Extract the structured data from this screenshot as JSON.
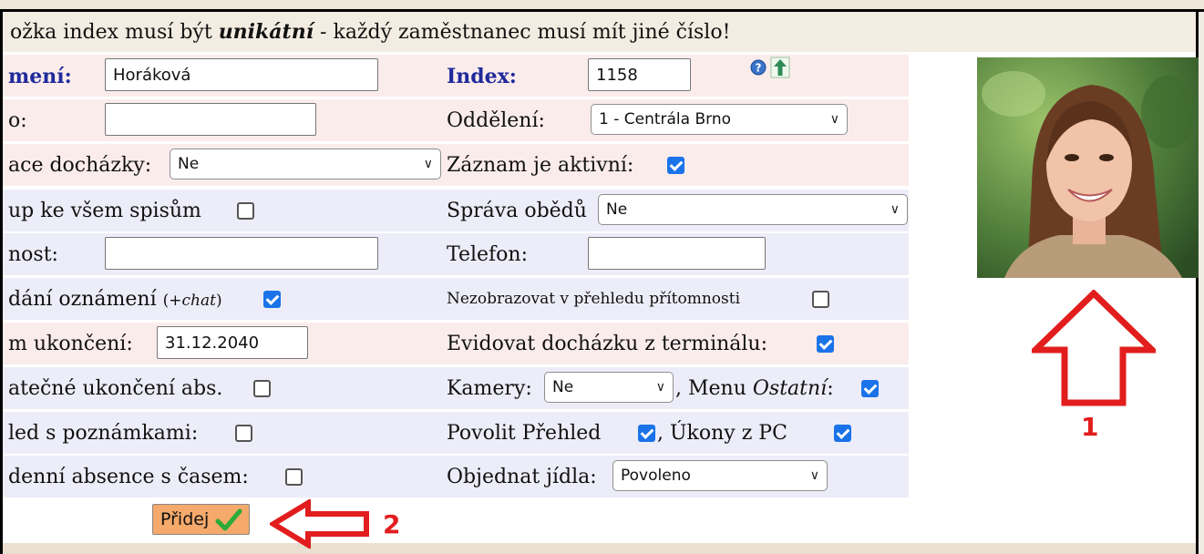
{
  "notice": {
    "prefix": "ožka index musí být ",
    "emph": "unikátní",
    "suffix": " - každý zaměstnanec musí mít jiné číslo!"
  },
  "form": {
    "surname_label": "mení:",
    "surname_value": "Horáková",
    "index_label": "Index:",
    "index_value": "1158",
    "row2_label": "o:",
    "row2_value": "",
    "department_label": "Oddělení:",
    "department_value": "1 - Centrála Brno",
    "attendance_label": "ace docházky:",
    "attendance_value": "Ne",
    "active_label": "Záznam je aktivní:",
    "files_label": "up ke všem spisům",
    "lunch_mgmt_label": "Správa obědů",
    "lunch_mgmt_value": "Ne",
    "position_label": "nost:",
    "position_value": "",
    "phone_label": "Telefon:",
    "phone_value": "",
    "announce_label": "dání oznámení",
    "announce_suffix_open": "(+",
    "announce_suffix_chat": "chat",
    "announce_suffix_close": ")",
    "hide_presence_label": "Nezobrazovat v přehledu přítomnosti",
    "end_date_label": "m ukončení:",
    "end_date_value": "31.12.2040",
    "terminal_label": "Evidovat docházku z terminálu:",
    "early_end_label": "atečné ukončení abs.",
    "cameras_label": "Kamery:",
    "cameras_value": "Ne",
    "menu_label_pre": ", Menu ",
    "menu_label_em": "Ostatní",
    "menu_label_post": ":",
    "notes_label": "led s poznámkami:",
    "overview_label": "Povolit Přehled",
    "pc_label": ",  Úkony z PC",
    "daily_abs_label": "denní absence s časem:",
    "meals_label": "Objednat jídla:",
    "meals_value": "Povoleno"
  },
  "button": {
    "add_label": "Přidej"
  },
  "annotations": {
    "one": "1",
    "two": "2"
  },
  "colors": {
    "annotation": "#e21d1d",
    "checkbox": "#1a73e8",
    "label_blue": "#1f2a9a"
  }
}
